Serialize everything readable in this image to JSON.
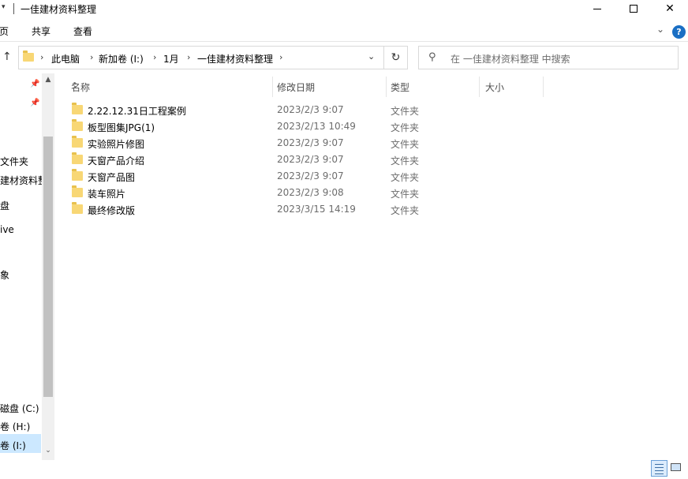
{
  "window": {
    "title": "一佳建材资料整理",
    "qa_arrow": "▾",
    "min_icon": "minimize-icon",
    "max_icon": "maximize-icon",
    "close_glyph": "✕"
  },
  "ribbon": {
    "tabs": [
      "页",
      "共享",
      "查看"
    ],
    "chevron": "⌄",
    "help": "?"
  },
  "address": {
    "up_glyph": "↑",
    "crumbs": [
      "此电脑",
      "新加卷 (I:)",
      "1月",
      "一佳建材资料整理"
    ],
    "separator": "›",
    "dropdown_glyph": "⌄",
    "refresh_glyph": "↻"
  },
  "search": {
    "placeholder": "在 一佳建材资料整理 中搜索",
    "icon_glyph": "⚲"
  },
  "nav": {
    "items": [
      "文件夹",
      "建材资料整",
      "盘",
      "ive",
      "象",
      "磁盘 (C:)",
      "卷 (H:)",
      "卷 (I:)"
    ],
    "pin_glyph": "📌",
    "scroll_up": "▲",
    "scroll_down": "⌄"
  },
  "columns": {
    "name": "名称",
    "date": "修改日期",
    "type": "类型",
    "size": "大小",
    "sort_glyph": "^"
  },
  "files": [
    {
      "name": "2.22.12.31日工程案例",
      "date": "2023/2/3 9:07",
      "type": "文件夹"
    },
    {
      "name": "板型图集JPG(1)",
      "date": "2023/2/13 10:49",
      "type": "文件夹"
    },
    {
      "name": "实验照片修图",
      "date": "2023/2/3 9:07",
      "type": "文件夹"
    },
    {
      "name": "天窗产品介绍",
      "date": "2023/2/3 9:07",
      "type": "文件夹"
    },
    {
      "name": "天窗产品图",
      "date": "2023/2/3 9:07",
      "type": "文件夹"
    },
    {
      "name": "装车照片",
      "date": "2023/2/3 9:08",
      "type": "文件夹"
    },
    {
      "name": "最终修改版",
      "date": "2023/3/15 14:19",
      "type": "文件夹"
    }
  ],
  "colors": {
    "accent": "#1a6fc4",
    "selection": "#cce8ff",
    "folder": "#f8d775"
  }
}
